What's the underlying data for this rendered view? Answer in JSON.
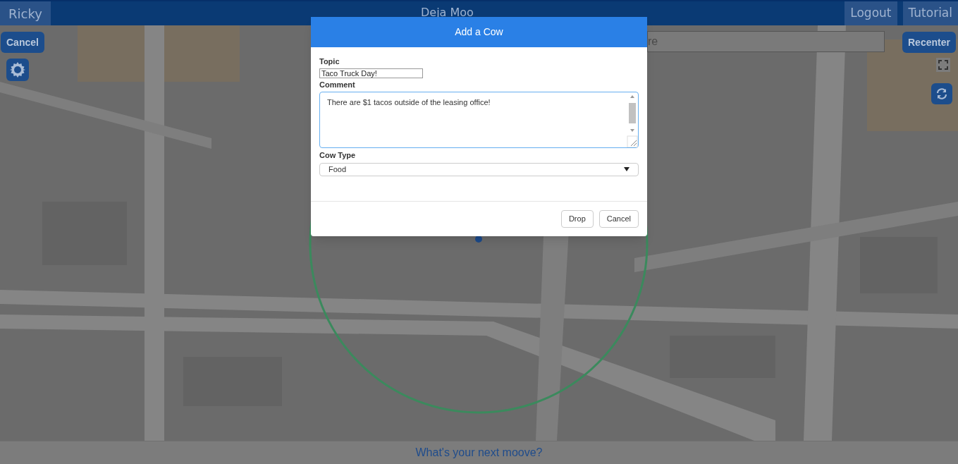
{
  "header": {
    "user": "Ricky",
    "title": "Deja Moo",
    "buttons": [
      "Logout",
      "Tutorial"
    ]
  },
  "map_controls": {
    "cancel": "Cancel",
    "recenter": "Recenter",
    "search": {
      "placeholder": "re"
    }
  },
  "dialog": {
    "title": "Add a Cow",
    "fields": [
      {
        "kind": "text",
        "label": "Topic",
        "value": "Taco Truck Day!"
      },
      {
        "kind": "textarea",
        "label": "Comment",
        "value": "There are $1 tacos outside of the leasing office!"
      },
      {
        "kind": "select",
        "label": "Cow Type",
        "value": "Food"
      }
    ],
    "buttons": [
      "Drop",
      "Cancel"
    ]
  },
  "footer": {
    "prompt": "What's your next moove?"
  }
}
